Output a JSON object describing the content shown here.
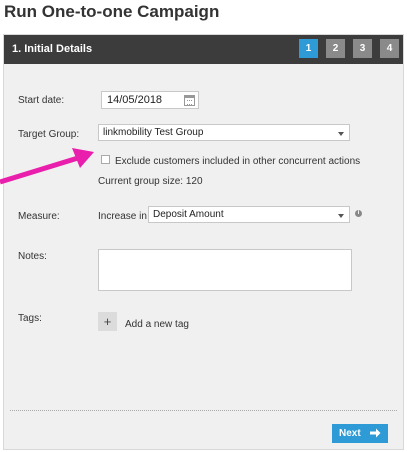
{
  "page": {
    "title": "Run One-to-one Campaign"
  },
  "header": {
    "step_title": "1. Initial Details",
    "steps": [
      "1",
      "2",
      "3",
      "4"
    ],
    "active_step": "1"
  },
  "form": {
    "start_date": {
      "label": "Start date:",
      "value": "14/05/2018"
    },
    "target_group": {
      "label": "Target Group:",
      "value": "linkmobility Test Group"
    },
    "exclude": {
      "label": "Exclude customers included in other concurrent actions",
      "checked": false
    },
    "group_size": "Current group size: 120",
    "measure": {
      "label": "Measure:",
      "prefix": "Increase in",
      "value": "Deposit Amount"
    },
    "notes": {
      "label": "Notes:",
      "value": ""
    },
    "tags": {
      "label": "Tags:",
      "add_button": "+",
      "add_label": "Add a new tag"
    }
  },
  "footer": {
    "next_label": "Next"
  },
  "colors": {
    "accent": "#2e9bd6",
    "header_bg": "#3c3c3c",
    "annotation_arrow": "#e91eac"
  }
}
